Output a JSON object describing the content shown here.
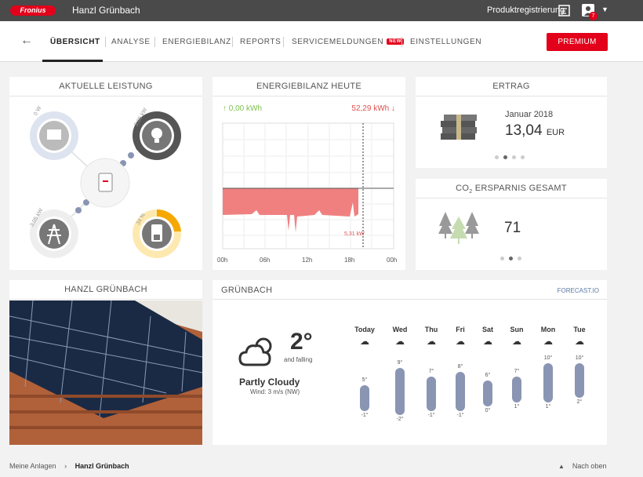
{
  "topbar": {
    "logo": "Fronius",
    "site_name": "Hanzl Grünbach",
    "product_registration": "Produktregistrierung",
    "notification_count": "7"
  },
  "nav": {
    "tabs": [
      "ÜBERSICHT",
      "ANALYSE",
      "ENERGIEBILANZ",
      "REPORTS",
      "SERVICEMELDUNGEN",
      "EINSTELLUNGEN"
    ],
    "new_badge": "NEW",
    "premium": "PREMIUM"
  },
  "current_power": {
    "title": "AKTUELLE LEISTUNG",
    "pv": "0 W",
    "load": "3,05 kW",
    "grid": "3,05 kW",
    "battery": "34 %"
  },
  "energy_balance": {
    "title": "ENERGIEBILANZ HEUTE",
    "produced": "↑ 0,00 kWh",
    "consumed": "52,29 kWh ↓",
    "current_value": "5,31 kW",
    "x_ticks": [
      "00h",
      "06h",
      "12h",
      "18h",
      "00h"
    ]
  },
  "chart_data": {
    "type": "area",
    "title": "ENERGIEBILANZ HEUTE",
    "x_ticks": [
      "00h",
      "06h",
      "12h",
      "18h",
      "00h"
    ],
    "annotation": "5,31 kW",
    "series": [
      {
        "name": "consumption",
        "note": "negative consumption area from 00h to ~19:30"
      }
    ]
  },
  "yield": {
    "title": "ERTRAG",
    "month": "Januar 2018",
    "amount": "13,04",
    "currency": "EUR"
  },
  "co2": {
    "title_prefix": "CO",
    "title_sub": "2",
    "title_suffix": " ERSPARNIS GESAMT",
    "value": "71"
  },
  "photo": {
    "title": "HANZL GRÜNBACH"
  },
  "weather": {
    "title": "GRÜNBACH",
    "source": "FORECAST.IO",
    "temp": "2°",
    "trend": "and falling",
    "summary": "Partly Cloudy",
    "wind": "Wind: 3 m/s (NW)",
    "days": [
      {
        "name": "Today",
        "high": "5°",
        "low": "-1°"
      },
      {
        "name": "Wed",
        "high": "9°",
        "low": "-2°"
      },
      {
        "name": "Thu",
        "high": "7°",
        "low": "-1°"
      },
      {
        "name": "Fri",
        "high": "8°",
        "low": "-1°"
      },
      {
        "name": "Sat",
        "high": "6°",
        "low": "0°"
      },
      {
        "name": "Sun",
        "high": "7°",
        "low": "1°"
      },
      {
        "name": "Mon",
        "high": "10°",
        "low": "1°"
      },
      {
        "name": "Tue",
        "high": "10°",
        "low": "2°"
      }
    ]
  },
  "footer": {
    "crumb_root": "Meine Anlagen",
    "crumb_current": "Hanzl Grünbach",
    "to_top": "Nach oben"
  },
  "colors": {
    "brand": "#e2001a",
    "chart_fill": "#f08080",
    "produced": "#7cbf4d",
    "temp_bar": "#8a95b3",
    "battery": "#f5a800"
  }
}
